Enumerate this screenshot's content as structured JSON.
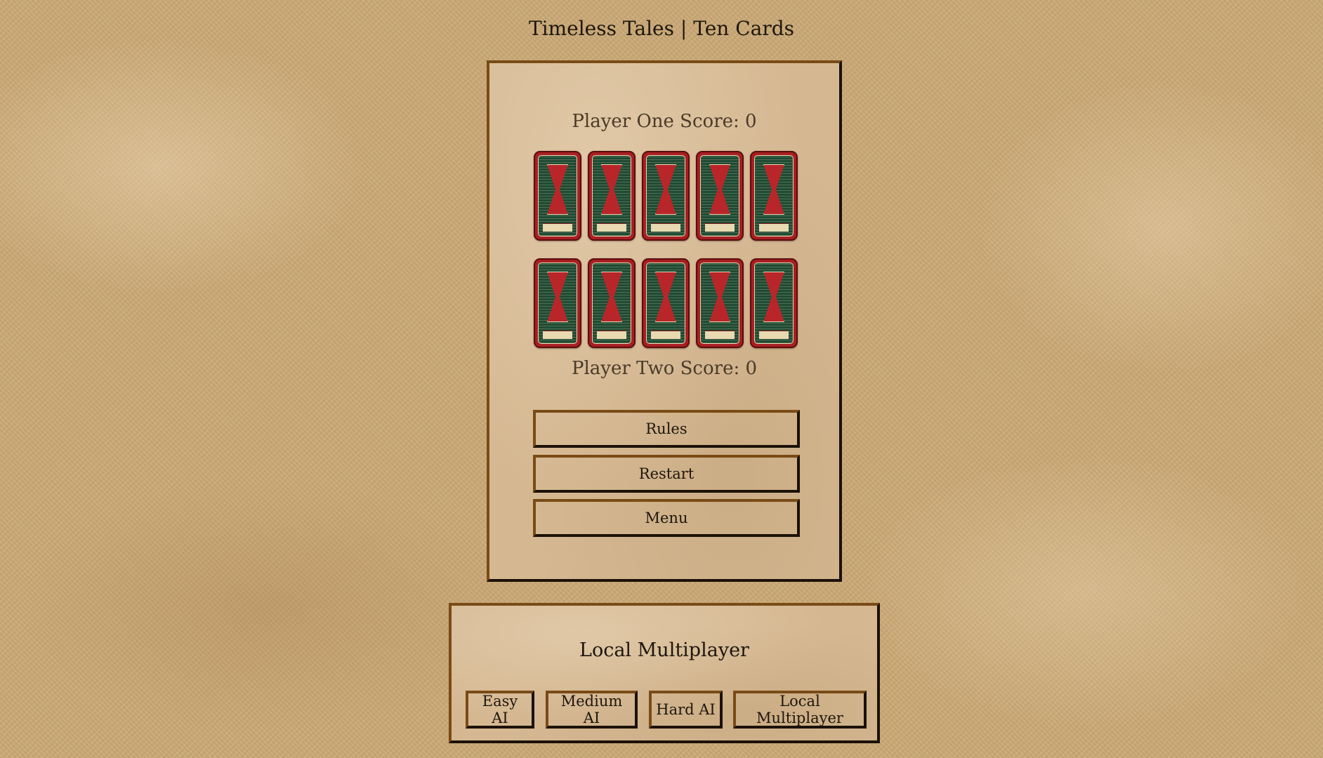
{
  "page": {
    "title": "Timeless Tales | Ten Cards"
  },
  "game": {
    "player_one_score": "Player One Score: 0",
    "player_two_score": "Player Two Score: 0",
    "cards_row_one": 5,
    "cards_row_two": 5,
    "card_back_colors": {
      "frame": "#a81f22",
      "field": "#1f4b34",
      "accent": "#e8d9b0"
    },
    "buttons": {
      "rules": "Rules",
      "restart": "Restart",
      "menu": "Menu"
    }
  },
  "mode_select": {
    "title": "Local Multiplayer",
    "options": {
      "easy": "Easy AI",
      "medium": "Medium AI",
      "hard": "Hard AI",
      "local": "Local Multiplayer"
    }
  },
  "colors": {
    "background": "#c9a877",
    "panel": "#d5b892",
    "border_light": "#7a4b16",
    "border_dark": "#1b1208",
    "text": "#1e160c"
  }
}
